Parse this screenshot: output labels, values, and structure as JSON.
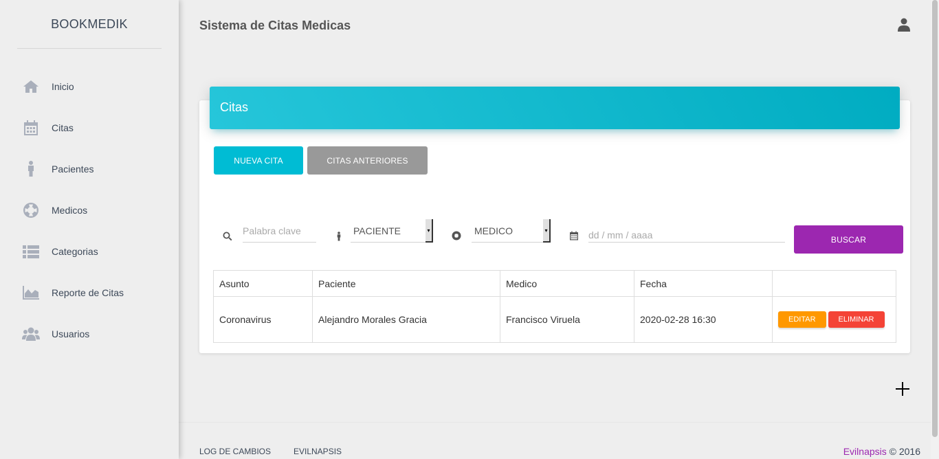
{
  "sidebar": {
    "brand": "BOOKMEDIK",
    "items": [
      {
        "label": "Inicio",
        "icon": "home-icon"
      },
      {
        "label": "Citas",
        "icon": "calendar-icon"
      },
      {
        "label": "Pacientes",
        "icon": "person-icon"
      },
      {
        "label": "Medicos",
        "icon": "life-ring-icon"
      },
      {
        "label": "Categorias",
        "icon": "list-icon"
      },
      {
        "label": "Reporte de Citas",
        "icon": "area-chart-icon"
      },
      {
        "label": "Usuarios",
        "icon": "users-icon"
      }
    ]
  },
  "header": {
    "title": "Sistema de Citas Medicas",
    "user_icon": "user-icon"
  },
  "card": {
    "title": "Citas",
    "new_button": "Nueva Cita",
    "previous_button": "Citas Anteriores"
  },
  "filters": {
    "keyword_placeholder": "Palabra clave",
    "patient_select": "PACIENTE",
    "doctor_select": "MEDICO",
    "date_placeholder": "dd / mm / aaaa",
    "search_button": "Buscar"
  },
  "table": {
    "headers": [
      "Asunto",
      "Paciente",
      "Medico",
      "Fecha",
      ""
    ],
    "rows": [
      {
        "asunto": "Coronavirus",
        "paciente": "Alejandro Morales Gracia",
        "medico": "Francisco Viruela",
        "fecha": "2020-02-28 16:30",
        "edit_label": "Editar",
        "delete_label": "Eliminar"
      }
    ]
  },
  "footer": {
    "link1": "Log de Cambios",
    "link2": "Evilnapsis",
    "brand": "Evilnapsis",
    "copyright": "© 2016"
  },
  "colors": {
    "primary_cyan": "#00bcd4",
    "purple": "#9c27b0",
    "orange": "#ff9800",
    "red": "#f44336",
    "gray": "#999999"
  }
}
